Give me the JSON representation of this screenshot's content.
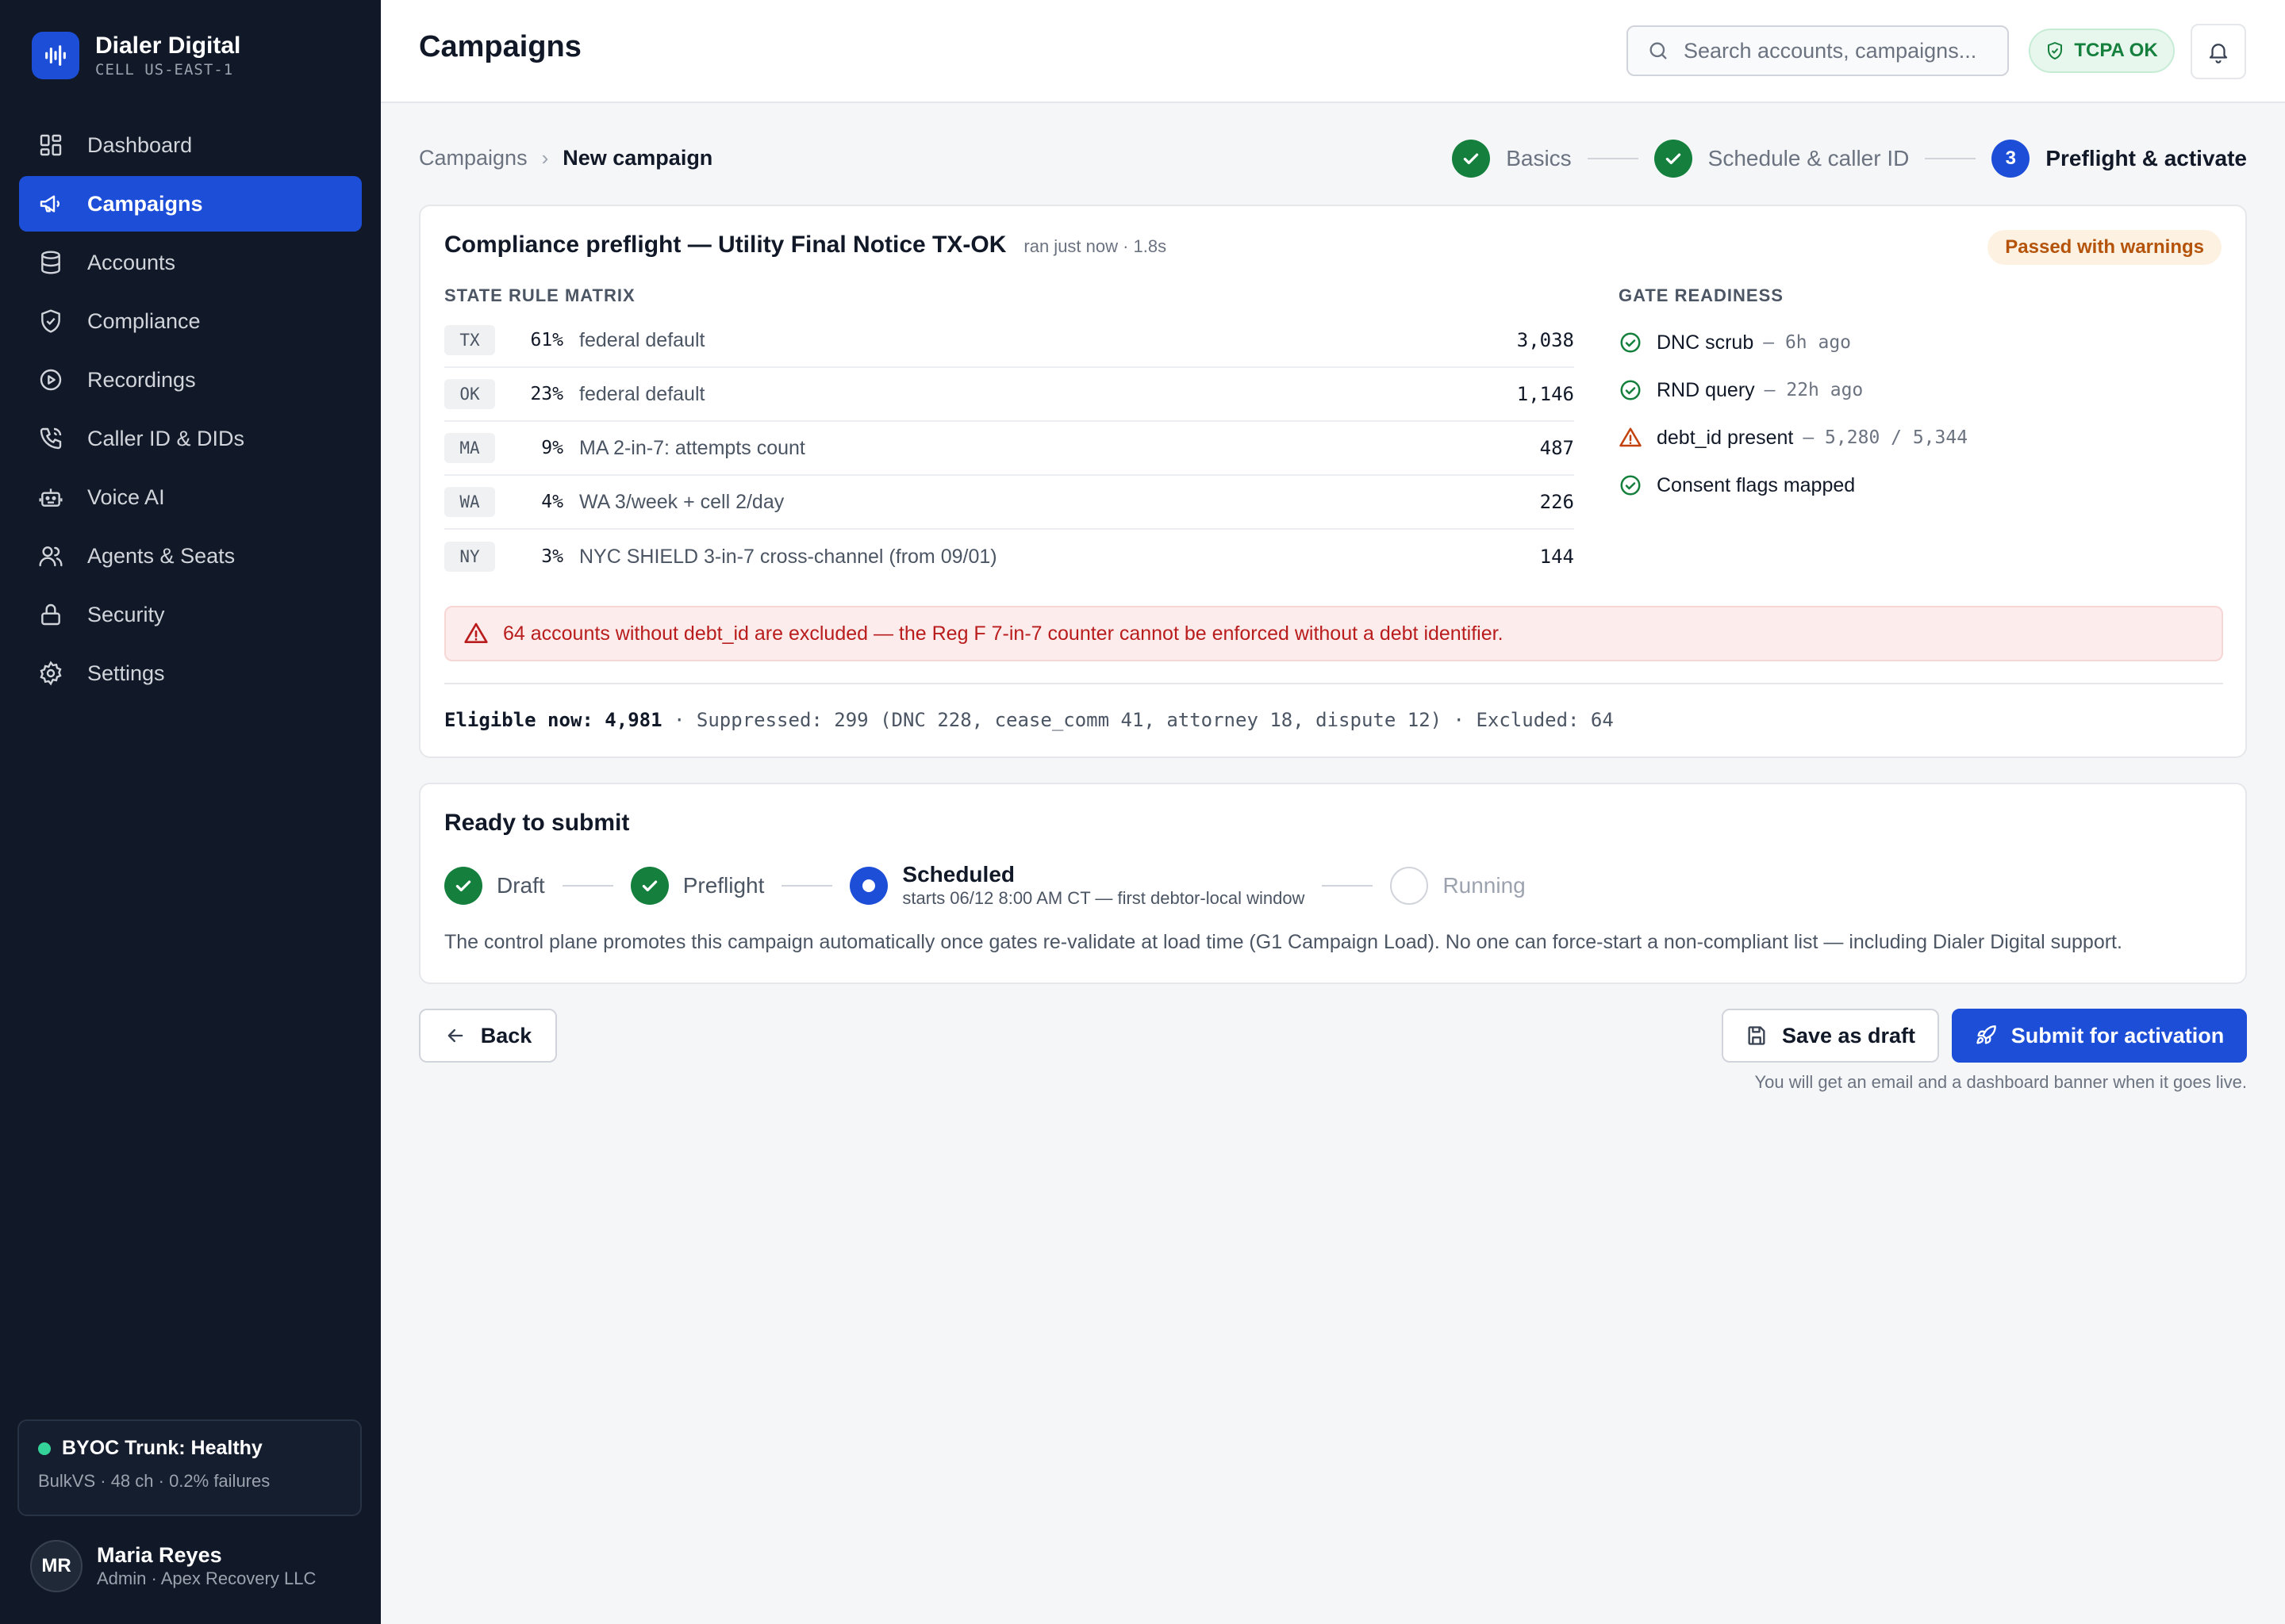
{
  "brand": {
    "name": "Dialer Digital",
    "cell": "CELL US-EAST-1"
  },
  "sidebar": {
    "items": [
      {
        "label": "Dashboard",
        "icon": "dashboard-icon"
      },
      {
        "label": "Campaigns",
        "icon": "megaphone-icon",
        "active": true
      },
      {
        "label": "Accounts",
        "icon": "database-icon"
      },
      {
        "label": "Compliance",
        "icon": "shield-icon"
      },
      {
        "label": "Recordings",
        "icon": "play-circle-icon"
      },
      {
        "label": "Caller ID & DIDs",
        "icon": "phone-icon"
      },
      {
        "label": "Voice AI",
        "icon": "bot-icon"
      },
      {
        "label": "Agents & Seats",
        "icon": "users-icon"
      },
      {
        "label": "Security",
        "icon": "lock-icon"
      },
      {
        "label": "Settings",
        "icon": "gear-icon"
      }
    ],
    "trunk": {
      "title": "BYOC Trunk: Healthy",
      "detail": "BulkVS · 48 ch · 0.2% failures",
      "status_color": "#34d399"
    },
    "user": {
      "initials": "MR",
      "name": "Maria Reyes",
      "role": "Admin · Apex Recovery LLC"
    }
  },
  "header": {
    "title": "Campaigns",
    "search_placeholder": "Search accounts, campaigns...",
    "tcpa_badge": "TCPA OK"
  },
  "breadcrumb": {
    "parent": "Campaigns",
    "separator": "›",
    "current": "New campaign"
  },
  "stepper": {
    "steps": [
      {
        "label": "Basics",
        "state": "done"
      },
      {
        "label": "Schedule & caller ID",
        "state": "done"
      },
      {
        "number": "3",
        "label": "Preflight & activate",
        "state": "current"
      }
    ]
  },
  "preflight": {
    "title": "Compliance preflight — Utility Final Notice TX-OK",
    "meta": "ran just now · 1.8s",
    "badge": "Passed with warnings",
    "matrix_label": "STATE RULE MATRIX",
    "rows": [
      {
        "state": "TX",
        "pct": "61%",
        "rule": "federal default",
        "count": "3,038"
      },
      {
        "state": "OK",
        "pct": "23%",
        "rule": "federal default",
        "count": "1,146"
      },
      {
        "state": "MA",
        "pct": "9%",
        "rule": "MA 2-in-7: attempts count",
        "count": "487"
      },
      {
        "state": "WA",
        "pct": "4%",
        "rule": "WA 3/week + cell 2/day",
        "count": "226"
      },
      {
        "state": "NY",
        "pct": "3%",
        "rule": "NYC SHIELD 3-in-7 cross-channel (from 09/01)",
        "count": "144"
      }
    ],
    "gates_label": "GATE READINESS",
    "gates": [
      {
        "name": "DNC scrub",
        "detail": "— 6h ago",
        "status": "ok"
      },
      {
        "name": "RND query",
        "detail": "— 22h ago",
        "status": "ok"
      },
      {
        "name": "debt_id present",
        "detail": "— 5,280 / 5,344",
        "status": "warning"
      },
      {
        "name": "Consent flags mapped",
        "detail": "",
        "status": "ok"
      }
    ],
    "alert": "64 accounts without debt_id are excluded — the Reg F 7-in-7 counter cannot be enforced without a debt identifier.",
    "summary": {
      "eligible": "Eligible now: 4,981",
      "rest": " · Suppressed: 299 (DNC 228, cease_comm 41, attorney 18, dispute 12) · Excluded: 64"
    }
  },
  "submit": {
    "title": "Ready to submit",
    "steps": [
      {
        "label": "Draft",
        "state": "done"
      },
      {
        "label": "Preflight",
        "state": "done"
      },
      {
        "label": "Scheduled",
        "note": "starts 06/12 8:00 AM CT — first debtor-local window",
        "state": "current"
      },
      {
        "label": "Running",
        "state": "pending"
      }
    ],
    "description": "The control plane promotes this campaign automatically once gates re-validate at load time (G1 Campaign Load). No one can force-start a non-compliant list — including Dialer Digital support."
  },
  "actions": {
    "back": "Back",
    "save_draft": "Save as draft",
    "submit": "Submit for activation",
    "note": "You will get an email and a dashboard banner when it goes live."
  },
  "colors": {
    "accent": "#1d4ed8",
    "success": "#15803d",
    "warning": "#b45309",
    "danger": "#b91c1c",
    "sidebar_bg": "#111827"
  }
}
